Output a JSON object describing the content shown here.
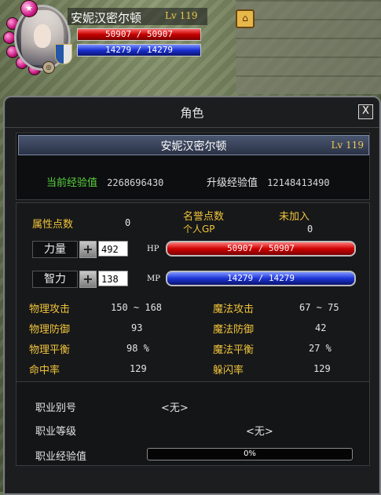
{
  "hud": {
    "player_name": "安妮汉密尔顿",
    "level_text": "Lv 119",
    "hp_text": "50907 / 50907",
    "mp_text": "14279 / 14279",
    "hp_fraction": 1.0,
    "mp_fraction": 1.0
  },
  "panel": {
    "title": "角色",
    "close_label": "X"
  },
  "character": {
    "name": "安妮汉密尔顿",
    "level_text": "Lv 119",
    "current_exp_label": "当前经验值",
    "current_exp_value": "2268696430",
    "upgrade_exp_label": "升级经验值",
    "upgrade_exp_value": "12148413490"
  },
  "points": {
    "attr_points_label": "属性点数",
    "attr_points_value": "0",
    "reputation_label": "名誉点数",
    "personal_gp_label": "个人GP",
    "reputation_value": "未加入",
    "personal_gp_value": "0"
  },
  "stats": {
    "strength_label": "力量",
    "strength_value": "492",
    "hp_label": "HP",
    "hp_text": "50907 / 50907",
    "intelligence_label": "智力",
    "intelligence_value": "138",
    "mp_label": "MP",
    "mp_text": "14279 / 14279",
    "plus_symbol": "+"
  },
  "combat": {
    "phys_attack_label": "物理攻击",
    "phys_attack_value": "150 ~ 168",
    "mag_attack_label": "魔法攻击",
    "mag_attack_value": "67 ~ 75",
    "phys_def_label": "物理防御",
    "phys_def_value": "93",
    "mag_def_label": "魔法防御",
    "mag_def_value": "42",
    "phys_balance_label": "物理平衡",
    "phys_balance_value": "98 %",
    "mag_balance_label": "魔法平衡",
    "mag_balance_value": "27 %",
    "hit_label": "命中率",
    "hit_value": "129",
    "dodge_label": "躲闪率",
    "dodge_value": "129"
  },
  "job": {
    "alias_label": "职业别号",
    "alias_value": "<无>",
    "level_label": "职业等级",
    "level_value": "<无>",
    "exp_label": "职业经验值",
    "exp_text": "0%",
    "exp_fraction": 0.0
  },
  "colors": {
    "hp_red": "#cf0000",
    "mp_blue": "#1c34d6",
    "gold_label": "#f0c43c",
    "green_label": "#59d33c"
  },
  "icons": [
    "portrait-avatar",
    "level-gem",
    "guild-shield-icon",
    "house-icon",
    "close-icon",
    "plus-icon"
  ]
}
